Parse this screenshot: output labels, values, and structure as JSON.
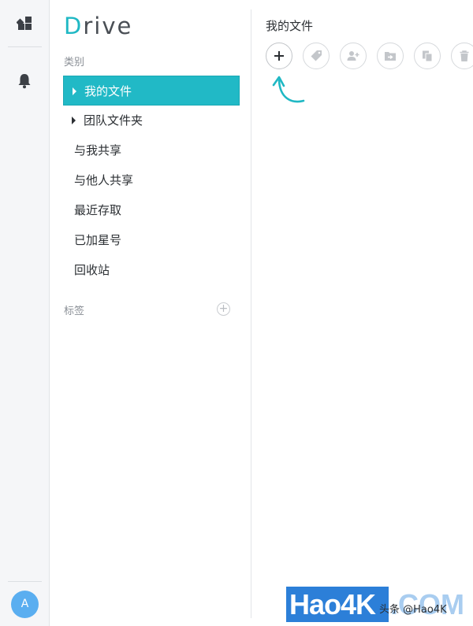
{
  "app": {
    "logo_first": "D",
    "logo_rest": "rive"
  },
  "rail": {
    "avatar_letter": "A"
  },
  "sidebar": {
    "category_heading": "类别",
    "items": [
      {
        "label": "我的文件",
        "active": true,
        "expandable": true
      },
      {
        "label": "团队文件夹",
        "active": false,
        "expandable": true
      },
      {
        "label": "与我共享",
        "active": false,
        "expandable": false
      },
      {
        "label": "与他人共享",
        "active": false,
        "expandable": false
      },
      {
        "label": "最近存取",
        "active": false,
        "expandable": false
      },
      {
        "label": "已加星号",
        "active": false,
        "expandable": false
      },
      {
        "label": "回收站",
        "active": false,
        "expandable": false
      }
    ],
    "tags_heading": "标签",
    "tags_add_symbol": "+"
  },
  "main": {
    "title": "我的文件",
    "toolbar_icons": [
      "plus-icon",
      "tag-icon",
      "add-user-icon",
      "move-folder-icon",
      "copy-icon",
      "trash-icon"
    ]
  },
  "watermark": {
    "brand": "Hao4K",
    "domain": ".COM",
    "source": "头条 @Hao4K"
  },
  "colors": {
    "accent": "#21b9c6",
    "rail_bg": "#f5f6f8",
    "avatar": "#5aaef0"
  }
}
